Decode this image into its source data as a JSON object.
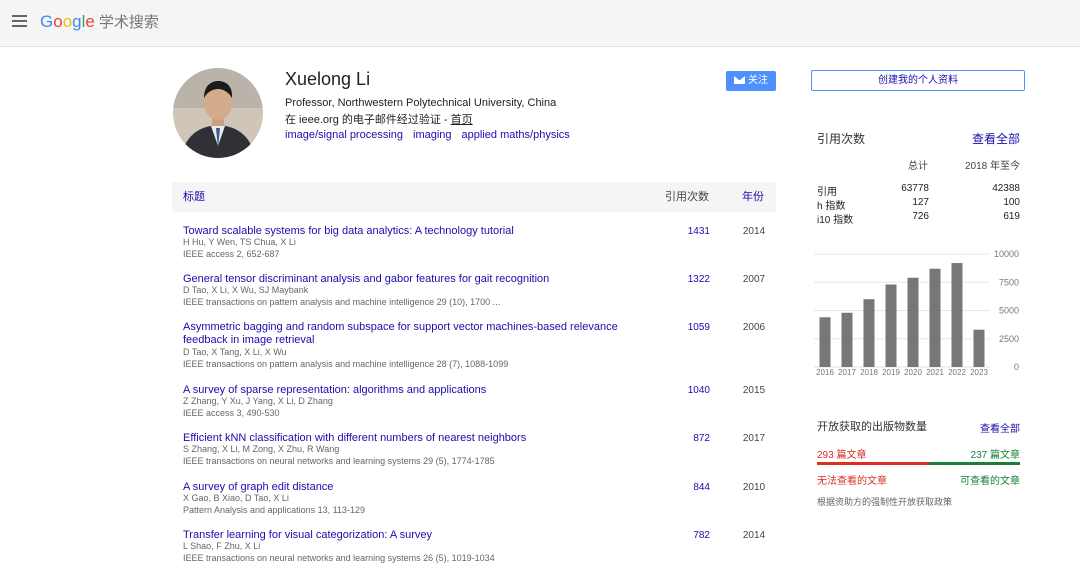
{
  "logo": {
    "letters": [
      "G",
      "o",
      "o",
      "g",
      "l",
      "e"
    ],
    "suffix": "学术搜索"
  },
  "profile": {
    "name": "Xuelong Li",
    "affiliation": "Professor, Northwestern Polytechnical University, China",
    "email_prefix": "在 ieee.org 的电子邮件经过验证 - ",
    "homepage_label": "首页",
    "interests": [
      "image/signal processing",
      "imaging",
      "applied maths/physics"
    ],
    "follow_label": "关注",
    "create_profile_label": "创建我的个人资料"
  },
  "table": {
    "col_title": "标题",
    "col_cited": "引用次数",
    "col_year": "年份",
    "rows": [
      {
        "title": "Toward scalable systems for big data analytics: A technology tutorial",
        "authors": "H Hu, Y Wen, TS Chua, X Li",
        "venue": "IEEE access 2, 652-687",
        "cites": "1431",
        "year": "2014"
      },
      {
        "title": "General tensor discriminant analysis and gabor features for gait recognition",
        "authors": "D Tao, X Li, X Wu, SJ Maybank",
        "venue": "IEEE transactions on pattern analysis and machine intelligence 29 (10), 1700 ...",
        "cites": "1322",
        "year": "2007"
      },
      {
        "title": "Asymmetric bagging and random subspace for support vector machines-based relevance feedback in image retrieval",
        "authors": "D Tao, X Tang, X Li, X Wu",
        "venue": "IEEE transactions on pattern analysis and machine intelligence 28 (7), 1088-1099",
        "cites": "1059",
        "year": "2006"
      },
      {
        "title": "A survey of sparse representation: algorithms and applications",
        "authors": "Z Zhang, Y Xu, J Yang, X Li, D Zhang",
        "venue": "IEEE access 3, 490-530",
        "cites": "1040",
        "year": "2015"
      },
      {
        "title": "Efficient kNN classification with different numbers of nearest neighbors",
        "authors": "S Zhang, X Li, M Zong, X Zhu, R Wang",
        "venue": "IEEE transactions on neural networks and learning systems 29 (5), 1774-1785",
        "cites": "872",
        "year": "2017"
      },
      {
        "title": "A survey of graph edit distance",
        "authors": "X Gao, B Xiao, D Tao, X Li",
        "venue": "Pattern Analysis and applications 13, 113-129",
        "cites": "844",
        "year": "2010"
      },
      {
        "title": "Transfer learning for visual categorization: A survey",
        "authors": "L Shao, F Zhu, X Li",
        "venue": "IEEE transactions on neural networks and learning systems 26 (5), 1019-1034",
        "cites": "782",
        "year": "2014"
      }
    ]
  },
  "cited_by": {
    "title": "引用次数",
    "view_all": "查看全部",
    "col_total": "总计",
    "col_recent": "2018 年至今",
    "rows": [
      {
        "label": "引用",
        "total": "63778",
        "recent": "42388"
      },
      {
        "label": "h 指数",
        "total": "127",
        "recent": "100"
      },
      {
        "label": "i10 指数",
        "total": "726",
        "recent": "619"
      }
    ]
  },
  "chart_data": {
    "type": "bar",
    "categories": [
      "2016",
      "2017",
      "2018",
      "2019",
      "2020",
      "2021",
      "2022",
      "2023"
    ],
    "values": [
      4400,
      4800,
      6000,
      7300,
      7900,
      8700,
      9200,
      3300
    ],
    "y_ticks": [
      "0",
      "2500",
      "5000",
      "7500",
      "10000"
    ],
    "ylim": [
      0,
      10000
    ],
    "bar_color": "#777777"
  },
  "open_access": {
    "title": "开放获取的出版物数量",
    "view_all": "查看全部",
    "unavailable_count": "293 篇文章",
    "available_count": "237 篇文章",
    "unavailable_label": "无法查看的文章",
    "available_label": "可查看的文章",
    "unavailable_fraction": 0.553,
    "note": "根据资助方的强制性开放获取政策",
    "red": "#d93025",
    "green": "#188038"
  }
}
